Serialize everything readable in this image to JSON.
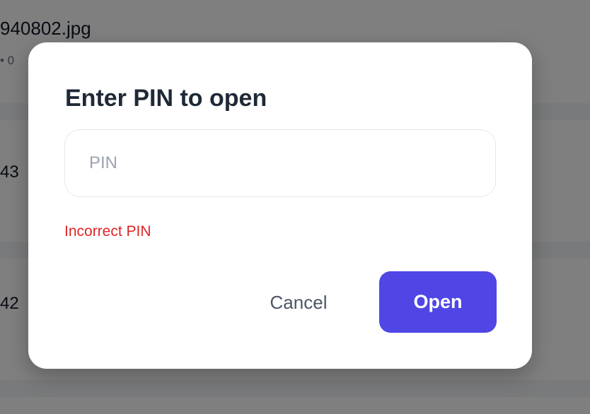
{
  "background": {
    "rows": [
      {
        "title": "940802.jpg",
        "meta": "• 0"
      },
      {
        "title": "43"
      },
      {
        "title": "42"
      }
    ]
  },
  "modal": {
    "title": "Enter PIN to open",
    "pin_input": {
      "value": "",
      "placeholder": "PIN"
    },
    "error": "Incorrect PIN",
    "cancel_label": "Cancel",
    "open_label": "Open",
    "colors": {
      "accent": "#4f46e5",
      "error": "#dc2626"
    }
  }
}
